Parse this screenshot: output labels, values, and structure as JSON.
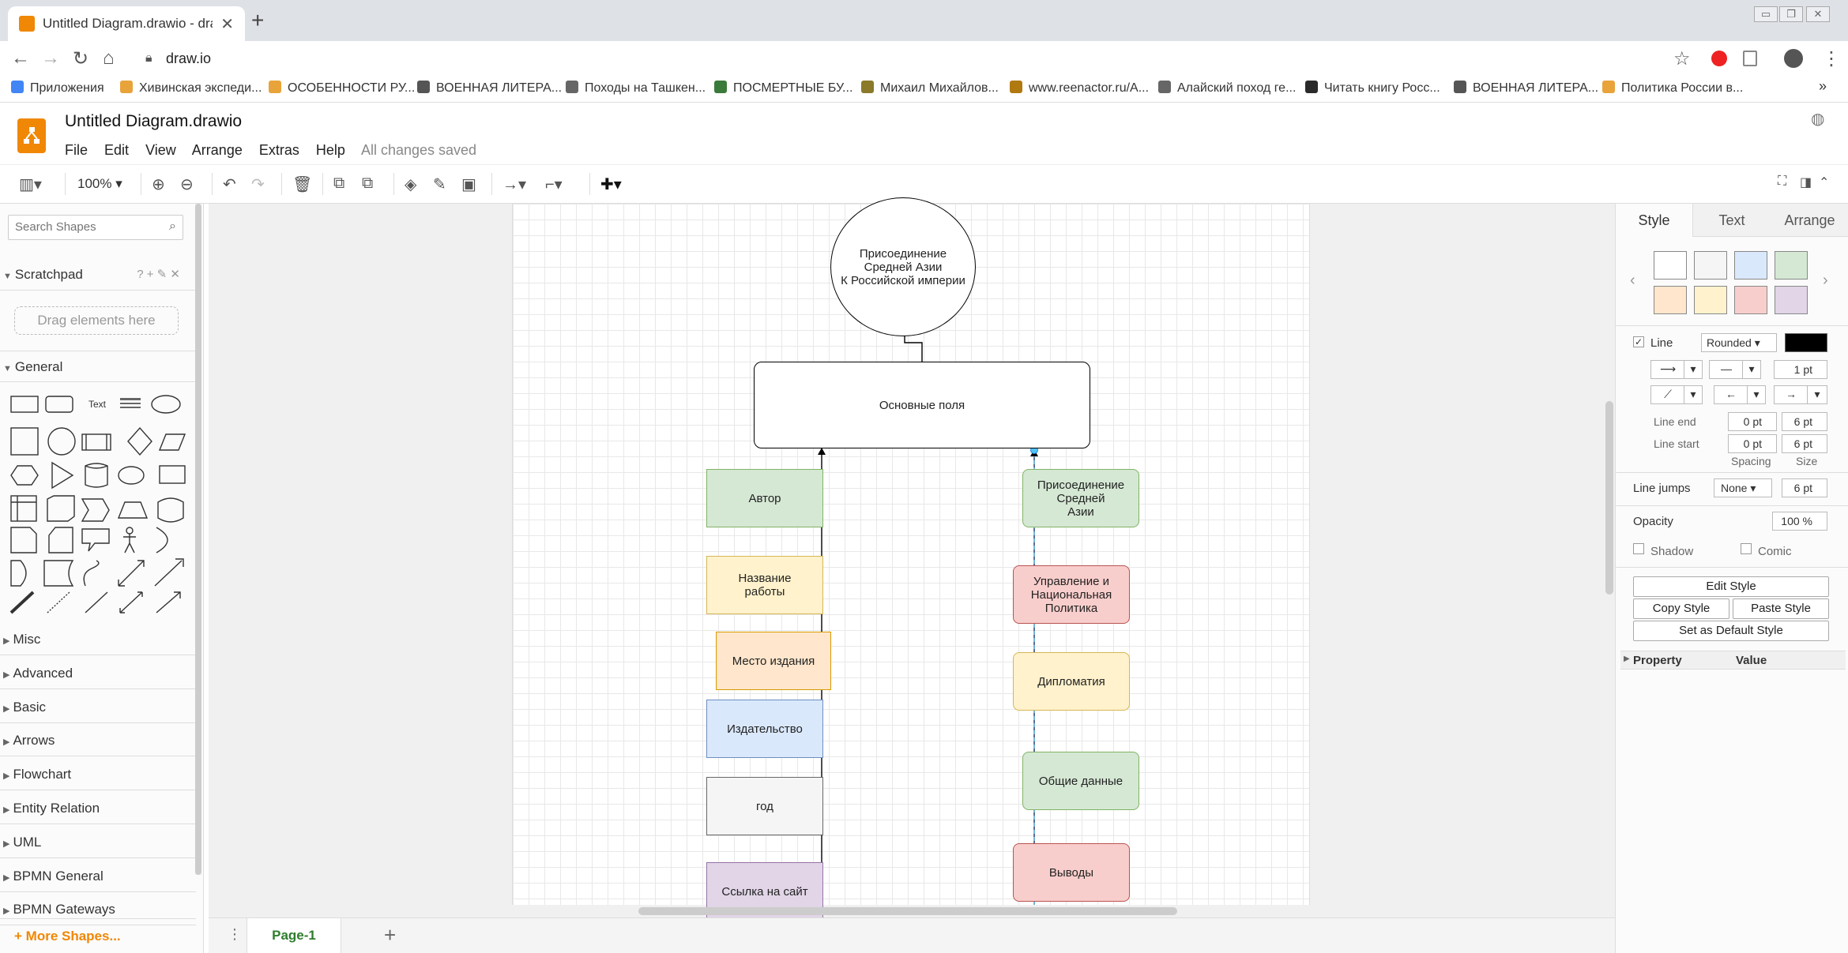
{
  "browser": {
    "tab_title": "Untitled Diagram.drawio - draw.io",
    "url": "draw.io",
    "bookmarks": [
      {
        "label": "Приложения",
        "color": "#4285f4"
      },
      {
        "label": "Хивинская экспеди...",
        "color": "#e8a33a"
      },
      {
        "label": "ОСОБЕННОСТИ РУ...",
        "color": "#e8a33a"
      },
      {
        "label": "ВОЕННАЯ ЛИТЕРА...",
        "color": "#555555"
      },
      {
        "label": "Походы на Ташкен...",
        "color": "#666666"
      },
      {
        "label": "ПОСМЕРТНЫЕ БУ...",
        "color": "#3a7a3a"
      },
      {
        "label": "Михаил Михайлов...",
        "color": "#8a7a2a"
      },
      {
        "label": "www.reenactor.ru/A...",
        "color": "#b07a10"
      },
      {
        "label": "Алайский поход ге...",
        "color": "#666666"
      },
      {
        "label": "Читать книгу Росс...",
        "color": "#2a2a2a"
      },
      {
        "label": "ВОЕННАЯ ЛИТЕРА...",
        "color": "#555555"
      },
      {
        "label": "Политика России в...",
        "color": "#e8a33a"
      }
    ],
    "more_bookmarks": "»"
  },
  "app": {
    "doc_title": "Untitled Diagram.drawio",
    "menu": [
      "File",
      "Edit",
      "View",
      "Arrange",
      "Extras",
      "Help"
    ],
    "save_status": "All changes saved"
  },
  "toolbar": {
    "zoom": "100%"
  },
  "left_panel": {
    "search_placeholder": "Search Shapes",
    "scratchpad_title": "Scratchpad",
    "scratchpad_tools": "? + ✎ ✕",
    "drag_hint": "Drag elements here",
    "general_title": "General",
    "text_shape": "Text",
    "sections": [
      "Misc",
      "Advanced",
      "Basic",
      "Arrows",
      "Flowchart",
      "Entity Relation",
      "UML",
      "BPMN General",
      "BPMN Gateways"
    ],
    "more_shapes": "More Shapes..."
  },
  "diagram": {
    "circle": {
      "label": "Присоединение\nСредней Азии\nК Российской империи"
    },
    "main_box": {
      "label": "Основные поля"
    },
    "left_boxes": [
      {
        "label": "Автор",
        "fill": "#d5e8d4",
        "stroke": "#82b366"
      },
      {
        "label": "Название\nработы",
        "fill": "#fff2cc",
        "stroke": "#d6b656"
      },
      {
        "label": "Место издания",
        "fill": "#ffe6cc",
        "stroke": "#d79b00"
      },
      {
        "label": "Издательство",
        "fill": "#dae8fc",
        "stroke": "#6c8ebf"
      },
      {
        "label": "год",
        "fill": "#f5f5f5",
        "stroke": "#666666"
      },
      {
        "label": "Ссылка на сайт",
        "fill": "#e1d5e7",
        "stroke": "#9673a6"
      }
    ],
    "right_boxes": [
      {
        "label": "Присоединение\nСредней\nАзии",
        "fill": "#d5e8d4",
        "stroke": "#82b366"
      },
      {
        "label": "Управление и\nНациональная\nПолитика",
        "fill": "#f8cecc",
        "stroke": "#b85450"
      },
      {
        "label": "Дипломатия",
        "fill": "#fff2cc",
        "stroke": "#d6b656"
      },
      {
        "label": "Общие данные",
        "fill": "#d5e8d4",
        "stroke": "#82b366"
      },
      {
        "label": "Выводы",
        "fill": "#f8cecc",
        "stroke": "#b85450"
      }
    ]
  },
  "bottom": {
    "page_tab": "Page-1"
  },
  "right_panel": {
    "tabs": [
      "Style",
      "Text",
      "Arrange"
    ],
    "swatches": [
      "#ffffff",
      "#f5f5f5",
      "#dae8fc",
      "#d5e8d4",
      "#ffe6cc",
      "#fff2cc",
      "#f8cecc",
      "#e1d5e7"
    ],
    "line_label": "Line",
    "line_style": "Rounded",
    "line_width": "1 pt",
    "line_end_label": "Line end",
    "line_start_label": "Line start",
    "line_end_spacing": "0 pt",
    "line_end_size": "6 pt",
    "line_start_spacing": "0 pt",
    "line_start_size": "6 pt",
    "spacing_label": "Spacing",
    "size_label": "Size",
    "line_jumps_label": "Line jumps",
    "line_jumps_value": "None",
    "line_jumps_size": "6 pt",
    "opacity_label": "Opacity",
    "opacity_value": "100 %",
    "shadow_label": "Shadow",
    "comic_label": "Comic",
    "edit_style": "Edit Style",
    "copy_style": "Copy Style",
    "paste_style": "Paste Style",
    "set_default_style": "Set as Default Style",
    "property_header": "Property",
    "value_header": "Value"
  }
}
